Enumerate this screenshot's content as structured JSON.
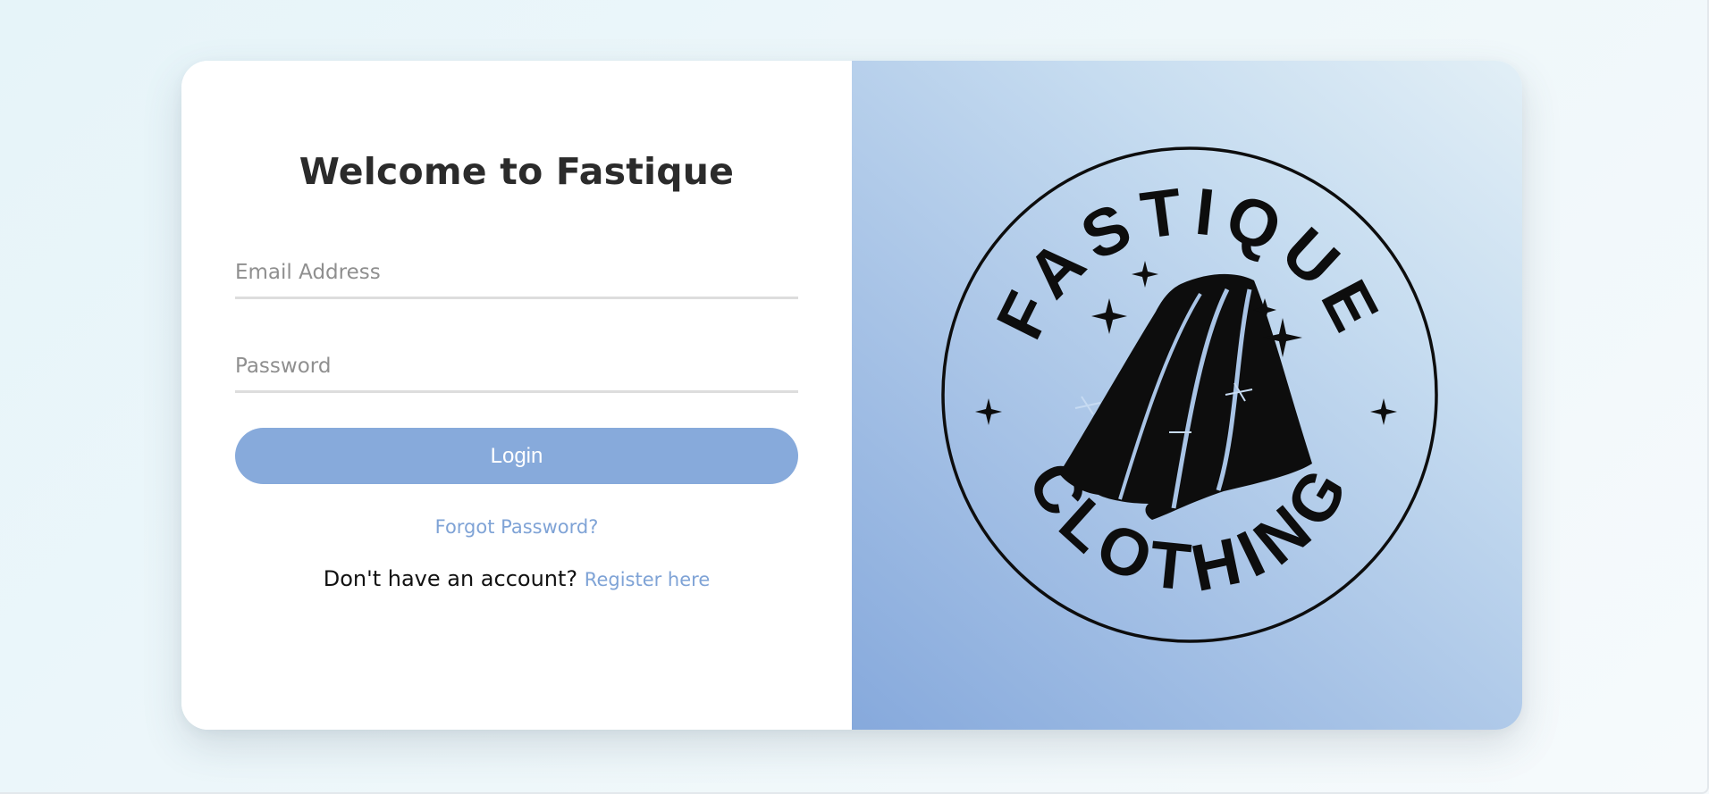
{
  "login": {
    "title": "Welcome to Fastique",
    "email_placeholder": "Email Address",
    "email_value": "",
    "password_placeholder": "Password",
    "password_value": "",
    "login_label": "Login",
    "forgot_label": "Forgot Password?",
    "register_prompt": "Don't have an account?",
    "register_link": "Register here"
  },
  "brand": {
    "logo_top_text": "FASTIQUE",
    "logo_bottom_text": "CLOTHING",
    "logo_icon": "flowing-garment-with-sparkles-icon"
  },
  "colors": {
    "accent": "#87aadb",
    "link": "#7fa3d6",
    "panel_gradient_start": "#86a9dc",
    "panel_gradient_end": "#e2eff6"
  }
}
